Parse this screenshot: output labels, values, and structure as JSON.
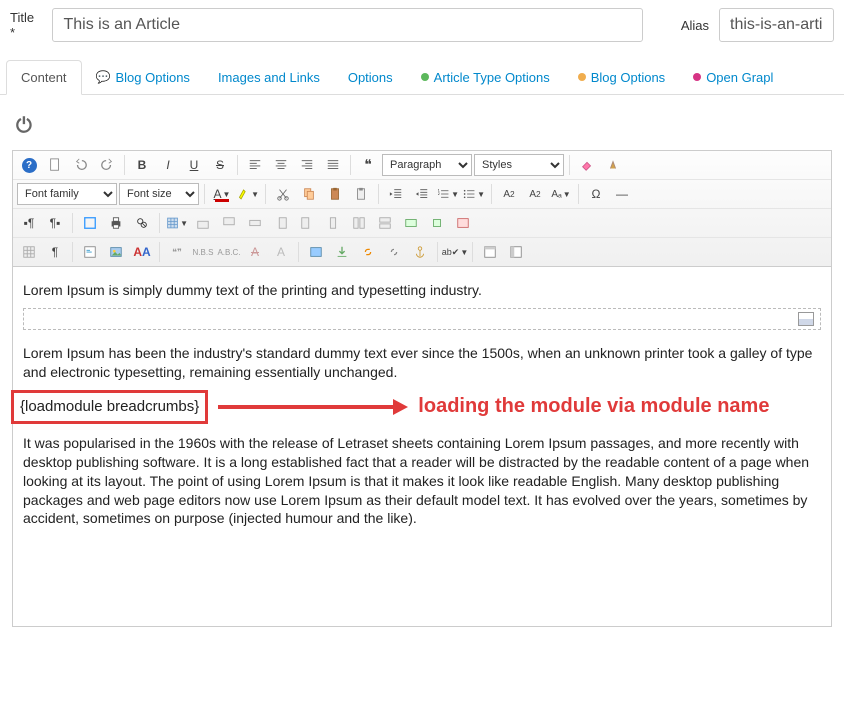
{
  "form": {
    "title_label": "Title *",
    "title_value": "This is an Article",
    "alias_label": "Alias",
    "alias_value": "this-is-an-article"
  },
  "tabs": {
    "content": "Content",
    "blog_options": "Blog Options",
    "images_links": "Images and Links",
    "options": "Options",
    "article_type": "Article Type Options",
    "blog_options2": "Blog Options",
    "open_graph": "Open Grapl"
  },
  "toolbar": {
    "paragraph": "Paragraph",
    "styles": "Styles",
    "font_family": "Font family",
    "font_size": "Font size"
  },
  "content": {
    "para1": "Lorem Ipsum is simply dummy text of the printing and typesetting industry.",
    "para2": "Lorem Ipsum has been the industry's standard dummy text ever since the 1500s, when an unknown printer took a galley of type and electronic typesetting, remaining essentially unchanged.",
    "module_code": "{loadmodule breadcrumbs}",
    "annotation": "loading the module via module name",
    "para3": "It was popularised in the 1960s with the release of Letraset sheets containing Lorem Ipsum passages, and more recently with desktop publishing software. It is a long established fact that a reader will be distracted by the readable content of a page when looking at its layout. The point of using Lorem Ipsum is that it makes it look like readable English. Many desktop publishing packages and web page editors now use Lorem Ipsum as their default model text. It has evolved over the years, sometimes by accident, sometimes on purpose (injected humour and the like)."
  }
}
